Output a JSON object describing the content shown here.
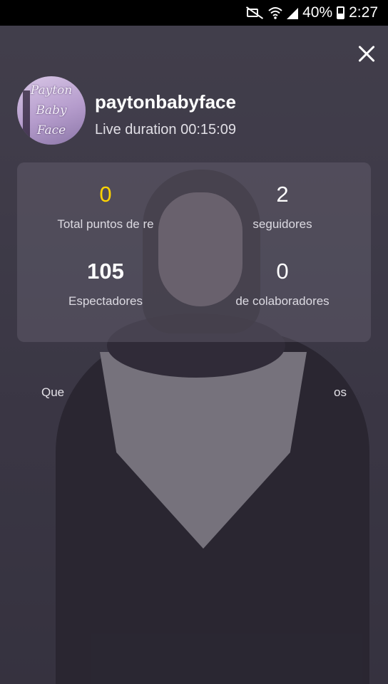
{
  "status_bar": {
    "battery_percent": "40%",
    "time": "2:27",
    "icons": [
      "mute-icon",
      "wifi-icon",
      "signal-icon",
      "battery-icon"
    ]
  },
  "close_icon": "close-icon",
  "profile": {
    "avatar_text": [
      "Payton",
      "Baby",
      "Face"
    ],
    "username": "paytonbabyface",
    "duration_label": "Live duration",
    "duration_value": "00:15:09"
  },
  "stats": [
    {
      "value": "0",
      "label": "Total puntos de re",
      "color": "#ffd400"
    },
    {
      "value": "2",
      "label": "seguidores",
      "color": "#ffffff"
    },
    {
      "value": "105",
      "label": "Espectadores",
      "color": "#ffffff"
    },
    {
      "value": "0",
      "label": "de colaboradores",
      "color": "#ffffff"
    }
  ],
  "footer": {
    "left": "Que",
    "right": "os"
  }
}
